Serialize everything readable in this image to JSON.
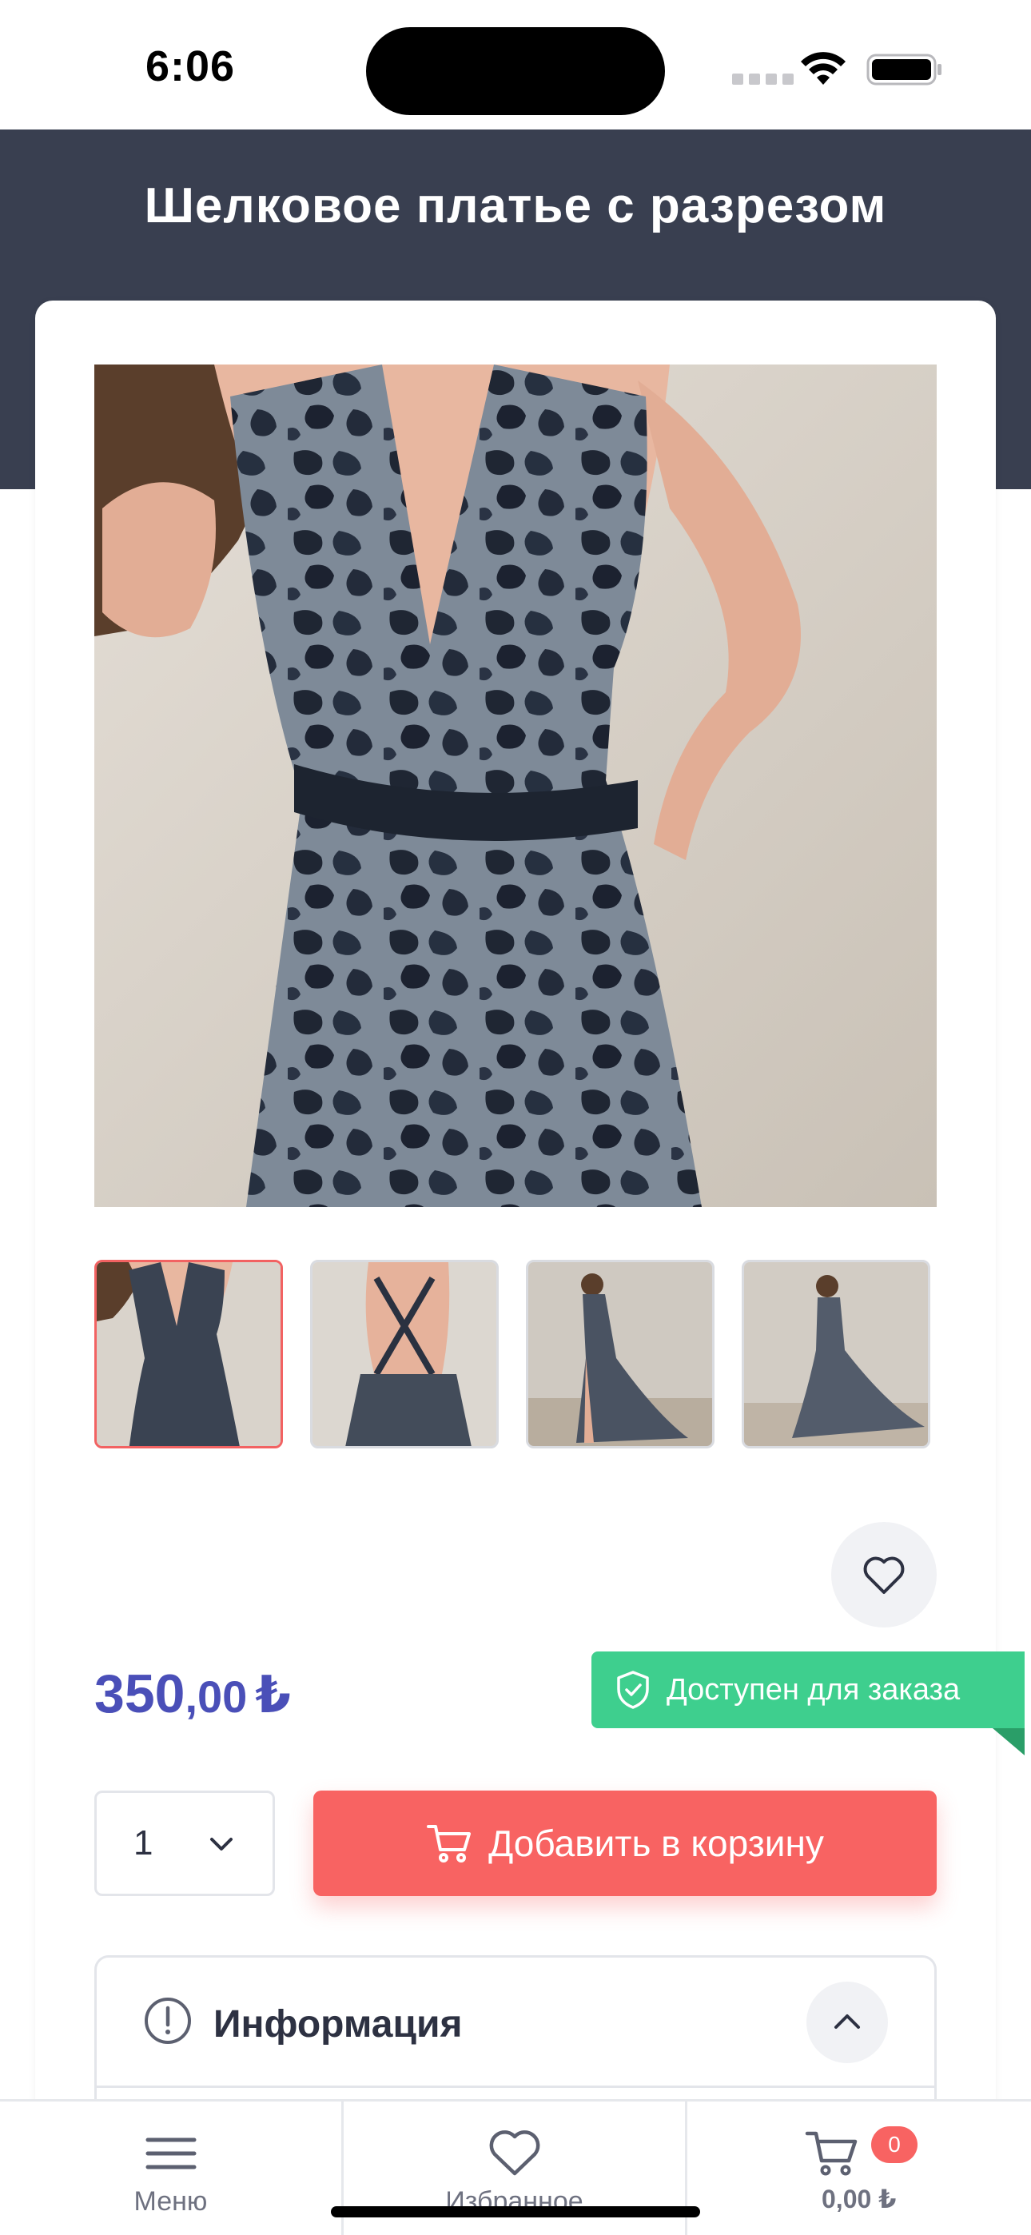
{
  "status_bar": {
    "time": "6:06"
  },
  "header": {
    "title": "Шелковое платье с разрезом"
  },
  "gallery": {
    "main_image": "dress-front-photo",
    "thumbnails": [
      "dress-front-photo",
      "dress-back-photo",
      "dress-side-photo",
      "dress-full-photo"
    ],
    "active_index": 0
  },
  "product": {
    "price_int": "350",
    "price_dec": ",00",
    "currency": "₺",
    "availability": "Доступен для заказа",
    "quantity": "1",
    "add_to_cart_label": "Добавить в корзину"
  },
  "info_section": {
    "title": "Информация"
  },
  "tab_bar": {
    "menu_label": "Меню",
    "favorites_label": "Избранное",
    "cart_count": "0",
    "cart_total": "0,00 ₺"
  },
  "colors": {
    "header_bg": "#393f50",
    "accent_red": "#f86362",
    "price_blue": "#4a4fb8",
    "available_green": "#3ecf8e"
  },
  "icons": {
    "favorite": "heart-icon",
    "availability": "shield-check-icon",
    "cart": "cart-icon",
    "info": "info-circle-icon",
    "menu": "hamburger-icon"
  }
}
